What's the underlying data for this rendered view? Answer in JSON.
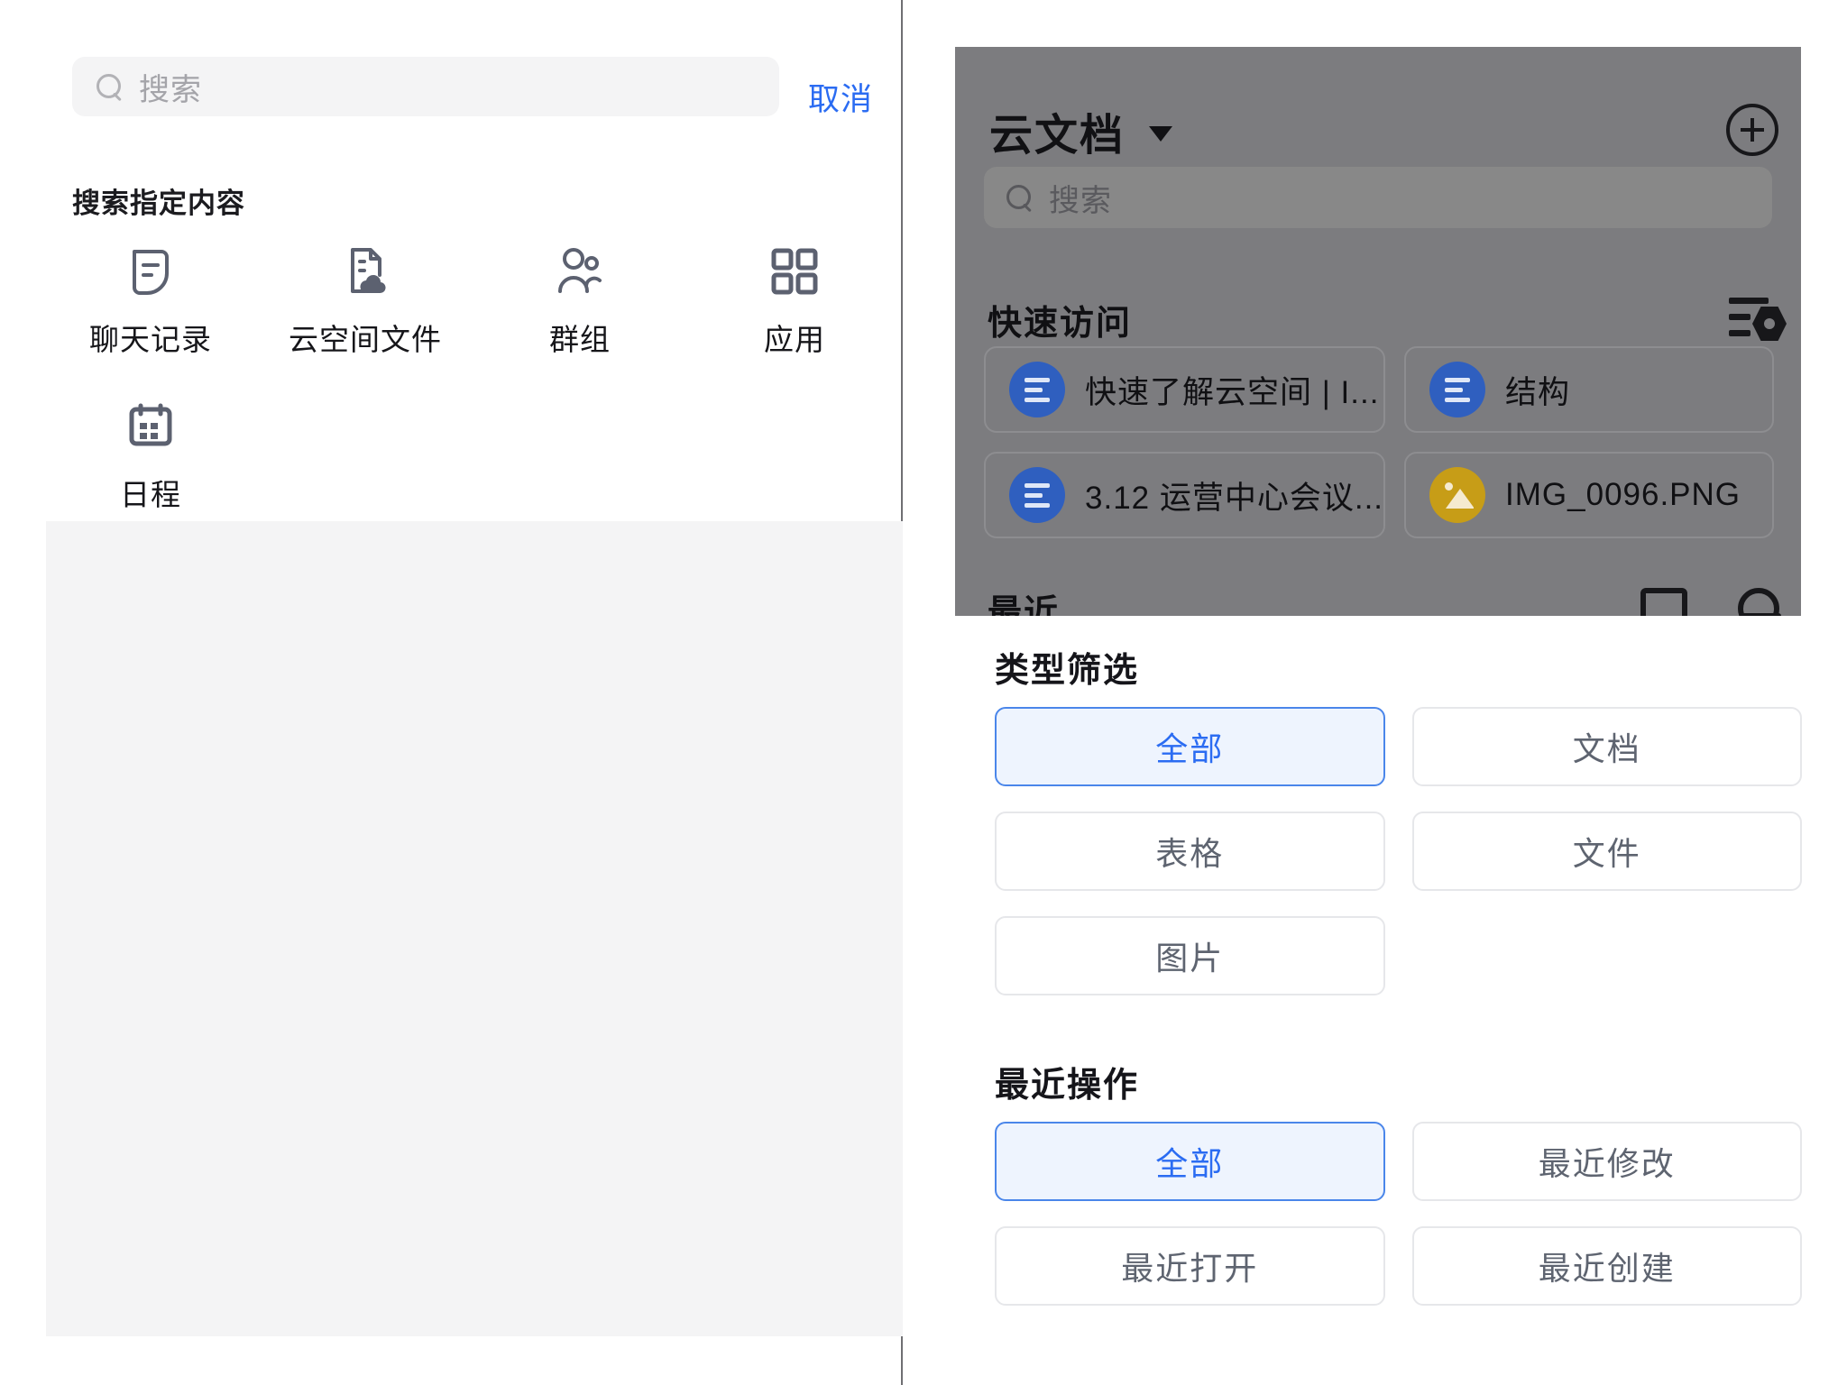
{
  "left_panel": {
    "search": {
      "placeholder": "搜索",
      "value": "",
      "icon": "search-icon"
    },
    "cancel_label": "取消",
    "section_title": "搜索指定内容",
    "shortcuts": [
      {
        "label": "聊天记录",
        "icon": "chat-record-icon"
      },
      {
        "label": "云空间文件",
        "icon": "cloud-file-icon"
      },
      {
        "label": "群组",
        "icon": "group-users-icon"
      },
      {
        "label": "应用",
        "icon": "apps-grid-icon"
      },
      {
        "label": "日程",
        "icon": "calendar-icon"
      }
    ]
  },
  "overlay_preview": {
    "title": "云文档",
    "title_caret": "chevron-down-icon",
    "add_button": "plus-circle-icon",
    "search": {
      "placeholder": "搜索",
      "value": ""
    },
    "quick_access_title": "快速访问",
    "sort_icon": "sort-filter-icon",
    "quick_access_items": [
      {
        "name": "快速了解云空间 | I...",
        "type": "doc",
        "accent": "#2f5fbf"
      },
      {
        "name": "结构",
        "type": "doc",
        "accent": "#2f5fbf"
      },
      {
        "name": "3.12 运营中心会议...",
        "type": "doc",
        "accent": "#2f5fbf"
      },
      {
        "name": "IMG_0096.PNG",
        "type": "image",
        "accent": "#c79d17"
      }
    ],
    "cut_off_section_title": "最近"
  },
  "filters": {
    "type_filter": {
      "title": "类型筛选",
      "options": [
        {
          "label": "全部",
          "selected": true
        },
        {
          "label": "文档",
          "selected": false
        },
        {
          "label": "表格",
          "selected": false
        },
        {
          "label": "文件",
          "selected": false
        },
        {
          "label": "图片",
          "selected": false
        }
      ]
    },
    "recent_operation": {
      "title": "最近操作",
      "options": [
        {
          "label": "全部",
          "selected": true
        },
        {
          "label": "最近修改",
          "selected": false
        },
        {
          "label": "最近打开",
          "selected": false
        },
        {
          "label": "最近创建",
          "selected": false
        }
      ]
    }
  },
  "colors": {
    "accent_blue": "#2b6cf2",
    "selected_chip_bg": "#eef4fe",
    "selected_chip_border": "#4a86ea",
    "overlay_dim": "#7c7c7f",
    "panel_grey": "#f4f4f5"
  }
}
